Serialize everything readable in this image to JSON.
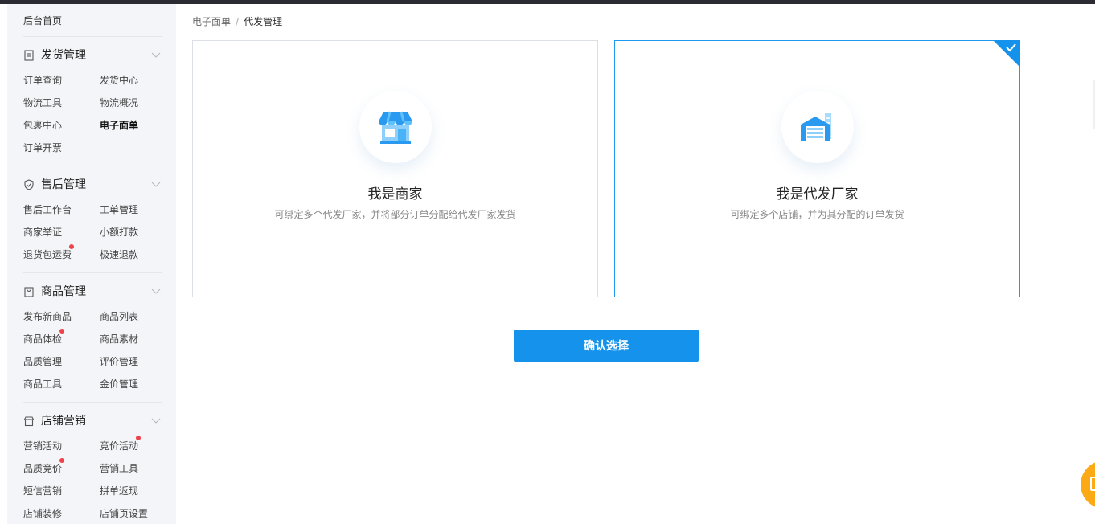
{
  "sidebar": {
    "home": "后台首页",
    "sections": [
      {
        "title": "发货管理",
        "items": [
          "订单查询",
          "发货中心",
          "物流工具",
          "物流概况",
          "包裹中心",
          "电子面单",
          "订单开票"
        ],
        "active": "电子面单"
      },
      {
        "title": "售后管理",
        "items": [
          "售后工作台",
          "工单管理",
          "商家举证",
          "小额打款",
          "退货包运费",
          "极速退款"
        ]
      },
      {
        "title": "商品管理",
        "items": [
          "发布新商品",
          "商品列表",
          "商品体检",
          "商品素材",
          "品质管理",
          "评价管理",
          "商品工具",
          "金价管理"
        ]
      },
      {
        "title": "店铺营销",
        "items": [
          "营销活动",
          "竞价活动",
          "品质竞价",
          "营销工具",
          "短信营销",
          "拼单返现",
          "店铺装修",
          "店铺页设置"
        ]
      }
    ]
  },
  "breadcrumb": {
    "parent": "电子面单",
    "separator": "/",
    "current": "代发管理"
  },
  "cards": [
    {
      "title": "我是商家",
      "desc": "可绑定多个代发厂家，并将部分订单分配给代发厂家发货",
      "icon": "shop-icon",
      "selected": false
    },
    {
      "title": "我是代发厂家",
      "desc": "可绑定多个店铺，并为其分配的订单发货",
      "icon": "warehouse-icon",
      "selected": true
    }
  ],
  "confirm_label": "确认选择",
  "colors": {
    "accent": "#1593ec",
    "badge": "#f0424b",
    "float": "#fba915",
    "sidebar_bg": "#f4f5f8"
  }
}
